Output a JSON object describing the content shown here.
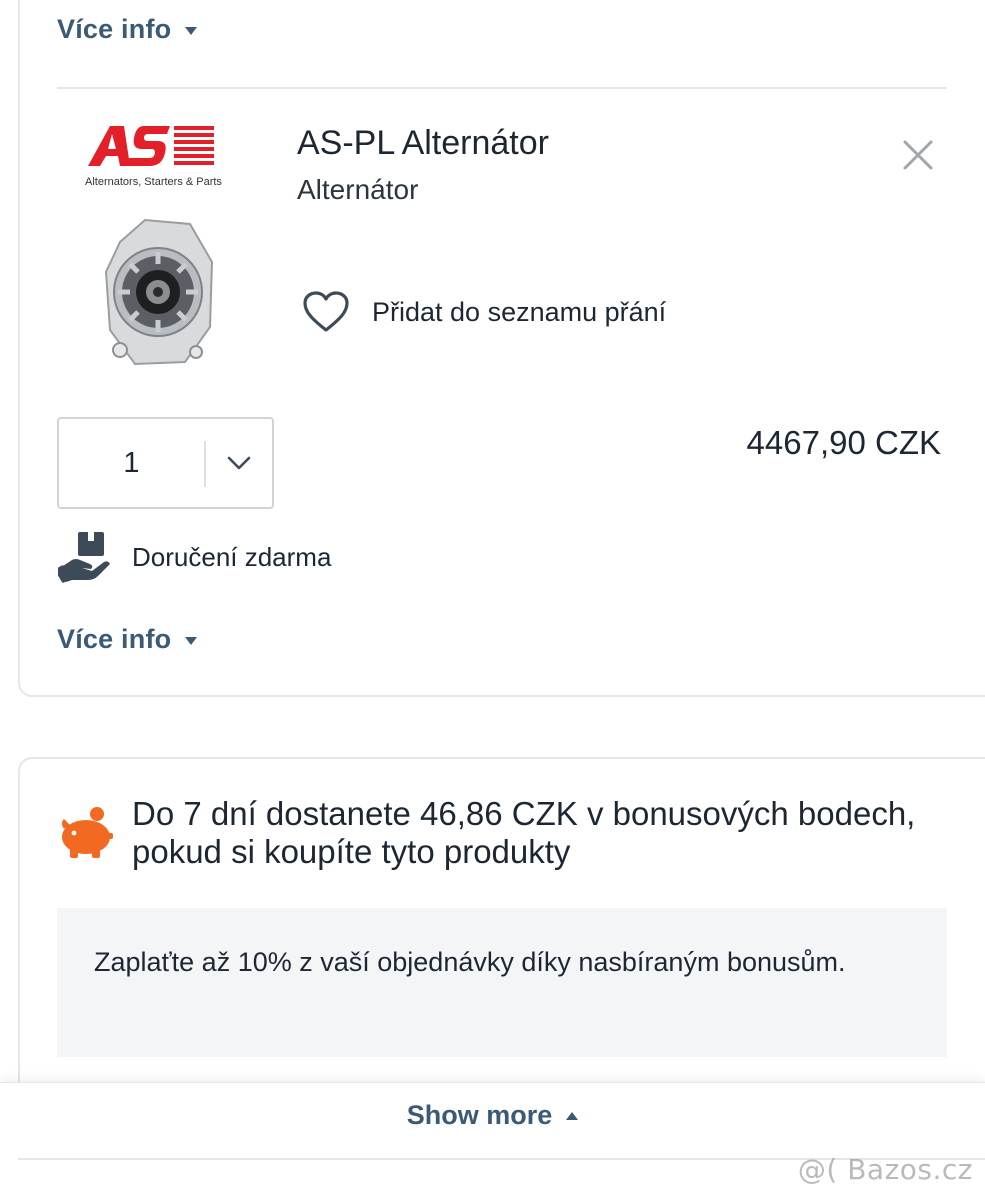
{
  "top": {
    "more_info": "Více info"
  },
  "product": {
    "brand_logo_text": "AS",
    "brand_tagline": "Alternators, Starters & Parts",
    "title": "AS-PL Alternátor",
    "subtitle": "Alternátor",
    "wishlist_label": "Přidat do seznamu přání",
    "quantity": "1",
    "price": "4467,90 CZK",
    "delivery_label": "Doručení zdarma",
    "more_info": "Více info",
    "icons": {
      "close": "close-icon",
      "heart": "heart-icon",
      "chevron": "chevron-down-icon",
      "delivery": "delivery-hand-icon"
    }
  },
  "bonus": {
    "heading": "Do 7 dní dostanete 46,86 CZK v bonusových bodech, pokud si koupíte tyto produkty",
    "info": "Zaplaťte až 10% z vaší objednávky díky nasbíraným bonusům.",
    "icon": "piggy-bank-icon",
    "accent": "#f26a21"
  },
  "footer": {
    "show_more": "Show more"
  },
  "watermark": "@( Bazos.cz",
  "colors": {
    "link": "#3a5a75",
    "logo_red": "#e3202a",
    "text": "#1d2733"
  }
}
